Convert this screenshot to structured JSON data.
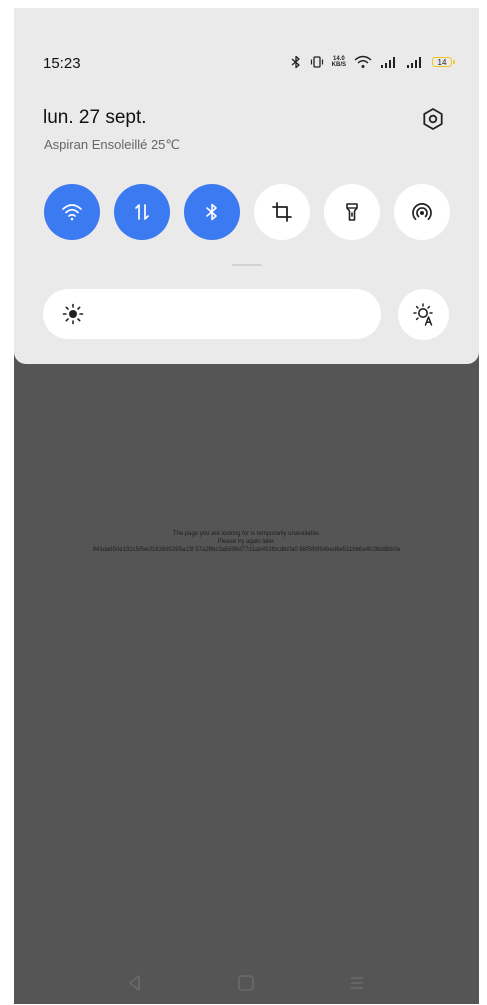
{
  "status_bar": {
    "time": "15:23",
    "network_speed_value": "14.0",
    "network_speed_unit": "KB/S",
    "battery_level": "14"
  },
  "quick_settings": {
    "date": "lun. 27 sept.",
    "weather": "Aspiran Ensoleillé 25℃",
    "tiles": [
      {
        "name": "wifi",
        "state": "on"
      },
      {
        "name": "mobile-data",
        "state": "on"
      },
      {
        "name": "bluetooth",
        "state": "on"
      },
      {
        "name": "screenshot",
        "state": "off"
      },
      {
        "name": "flashlight",
        "state": "off"
      },
      {
        "name": "hotspot",
        "state": "off"
      }
    ],
    "accent_color": "#3b7af0"
  },
  "background_page": {
    "line1": "The page you are looking for is temporarily unavailable.",
    "line2": "Please try again later.",
    "line3": "943da650e132c5f5ecf1838d0295a13f 57a26bc3a5898d77d1ab452fbcdbcfa0 88f5fb954bed6e511bb6a4fc3bd9bb0e"
  }
}
